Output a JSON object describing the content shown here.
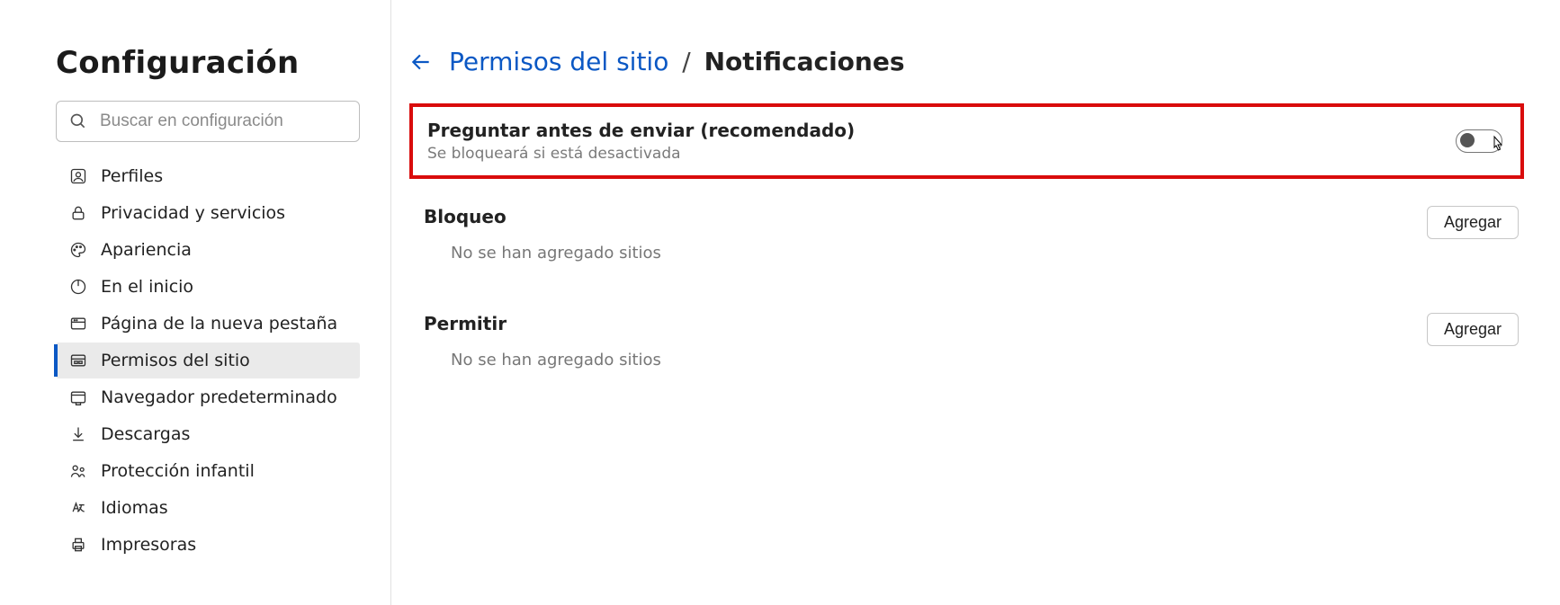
{
  "sidebar": {
    "title": "Configuración",
    "search_placeholder": "Buscar en configuración",
    "items": [
      {
        "label": "Perfiles",
        "icon": "profile-icon",
        "active": false
      },
      {
        "label": "Privacidad y servicios",
        "icon": "lock-icon",
        "active": false
      },
      {
        "label": "Apariencia",
        "icon": "appearance-icon",
        "active": false
      },
      {
        "label": "En el inicio",
        "icon": "power-icon",
        "active": false
      },
      {
        "label": "Página de la nueva pestaña",
        "icon": "newtab-icon",
        "active": false
      },
      {
        "label": "Permisos del sitio",
        "icon": "permissions-icon",
        "active": true
      },
      {
        "label": "Navegador predeterminado",
        "icon": "browser-icon",
        "active": false
      },
      {
        "label": "Descargas",
        "icon": "download-icon",
        "active": false
      },
      {
        "label": "Protección infantil",
        "icon": "family-icon",
        "active": false
      },
      {
        "label": "Idiomas",
        "icon": "language-icon",
        "active": false
      },
      {
        "label": "Impresoras",
        "icon": "printer-icon",
        "active": false
      }
    ]
  },
  "breadcrumb": {
    "parent": "Permisos del sitio",
    "separator": "/",
    "current": "Notificaciones"
  },
  "main": {
    "ask_before": {
      "title": "Preguntar antes de enviar (recomendado)",
      "subtitle": "Se bloqueará si está desactivada",
      "toggle_on": false
    },
    "block": {
      "title": "Bloqueo",
      "empty": "No se han agregado sitios",
      "add_label": "Agregar"
    },
    "allow": {
      "title": "Permitir",
      "empty": "No se han agregado sitios",
      "add_label": "Agregar"
    }
  }
}
